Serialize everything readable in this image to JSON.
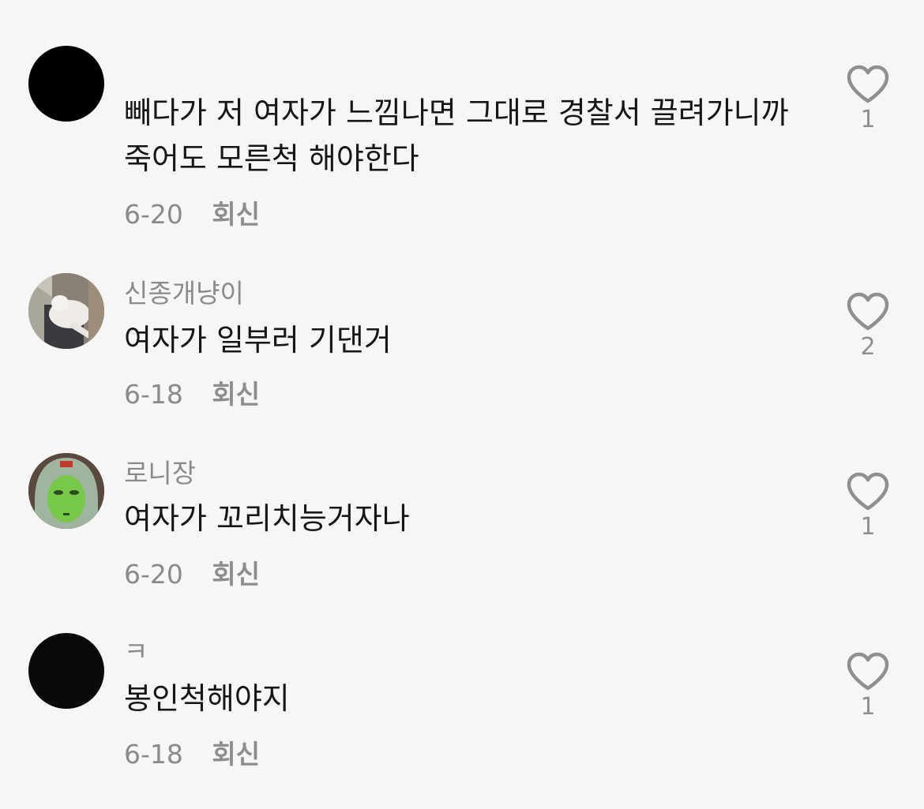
{
  "comments": [
    {
      "author": "",
      "text": "빼다가 저 여자가 느낌나면 그대로 경찰서 끌려가니까 죽어도 모른척 해야한다",
      "date": "6-20",
      "reply_label": "회신",
      "likes": "1",
      "avatar": "black-circle-avatar"
    },
    {
      "author": "신종개냥이",
      "text": "여자가 일부러 기댄거",
      "date": "6-18",
      "reply_label": "회신",
      "likes": "2",
      "avatar": "cat-photo-avatar"
    },
    {
      "author": "로니장",
      "text": "여자가 꼬리치능거자나",
      "date": "6-20",
      "reply_label": "회신",
      "likes": "1",
      "avatar": "green-mask-helmet-avatar"
    },
    {
      "author": "ㅋ",
      "text": "봉인척해야지",
      "date": "6-18",
      "reply_label": "회신",
      "likes": "1",
      "avatar": "dark-avatar"
    }
  ],
  "icons": {
    "like": "heart-outline-icon"
  },
  "colors": {
    "background": "#f6f6f6",
    "text": "#161616",
    "secondary": "#8a8a8a"
  }
}
